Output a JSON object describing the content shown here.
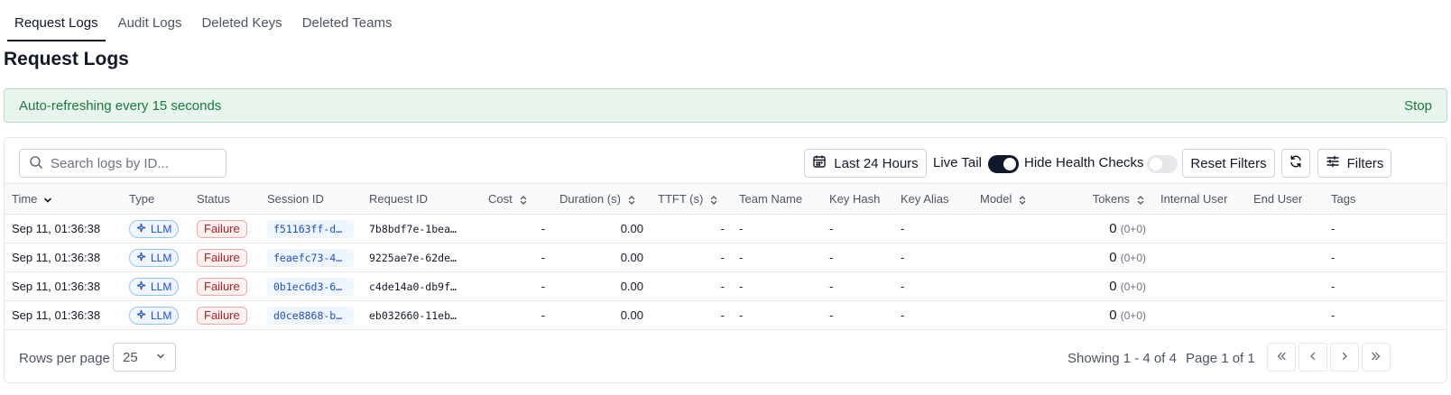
{
  "tabs": [
    {
      "label": "Request Logs",
      "active": true
    },
    {
      "label": "Audit Logs",
      "active": false
    },
    {
      "label": "Deleted Keys",
      "active": false
    },
    {
      "label": "Deleted Teams",
      "active": false
    }
  ],
  "page": {
    "title": "Request Logs"
  },
  "banner": {
    "message": "Auto-refreshing every 15 seconds",
    "stop_label": "Stop"
  },
  "toolbar": {
    "search_placeholder": "Search logs by ID...",
    "time_range_label": "Last 24 Hours",
    "live_tail_label": "Live Tail",
    "live_tail_on": true,
    "hide_health_label": "Hide Health Checks",
    "hide_health_on": false,
    "reset_label": "Reset Filters",
    "filters_label": "Filters"
  },
  "table": {
    "columns": [
      "Time",
      "Type",
      "Status",
      "Session ID",
      "Request ID",
      "Cost",
      "Duration (s)",
      "TTFT (s)",
      "Team Name",
      "Key Hash",
      "Key Alias",
      "Model",
      "Tokens",
      "Internal User",
      "End User",
      "Tags"
    ],
    "rows": [
      {
        "time": "Sep 11, 01:36:38",
        "type": "LLM",
        "status": "Failure",
        "session_id": "f51163ff-da…",
        "request_id": "7b8bdf7e-1bea…",
        "cost": "-",
        "duration": "0.00",
        "ttft": "-",
        "team_name": "-",
        "key_hash": "-",
        "key_alias": "-",
        "model": "",
        "tokens": "0",
        "tokens_detail": "(0+0)",
        "internal_user": "",
        "end_user": "",
        "tags": "-"
      },
      {
        "time": "Sep 11, 01:36:38",
        "type": "LLM",
        "status": "Failure",
        "session_id": "feaefc73-41…",
        "request_id": "9225ae7e-62de…",
        "cost": "-",
        "duration": "0.00",
        "ttft": "-",
        "team_name": "-",
        "key_hash": "-",
        "key_alias": "-",
        "model": "",
        "tokens": "0",
        "tokens_detail": "(0+0)",
        "internal_user": "",
        "end_user": "",
        "tags": "-"
      },
      {
        "time": "Sep 11, 01:36:38",
        "type": "LLM",
        "status": "Failure",
        "session_id": "0b1ec6d3-61…",
        "request_id": "c4de14a0-db9f…",
        "cost": "-",
        "duration": "0.00",
        "ttft": "-",
        "team_name": "-",
        "key_hash": "-",
        "key_alias": "-",
        "model": "",
        "tokens": "0",
        "tokens_detail": "(0+0)",
        "internal_user": "",
        "end_user": "",
        "tags": "-"
      },
      {
        "time": "Sep 11, 01:36:38",
        "type": "LLM",
        "status": "Failure",
        "session_id": "d0ce8868-b8…",
        "request_id": "eb032660-11eb…",
        "cost": "-",
        "duration": "0.00",
        "ttft": "-",
        "team_name": "-",
        "key_hash": "-",
        "key_alias": "-",
        "model": "",
        "tokens": "0",
        "tokens_detail": "(0+0)",
        "internal_user": "",
        "end_user": "",
        "tags": "-"
      }
    ]
  },
  "footer": {
    "rows_per_page_label": "Rows per page",
    "rows_per_page_value": "25",
    "showing_text": "Showing 1 - 4 of 4",
    "page_text": "Page 1 of 1"
  },
  "colors": {
    "banner_bg": "#e8f5ec",
    "banner_text": "#1a7a3c",
    "type_badge": "#1d4ed8",
    "failure_badge": "#b91c1c",
    "toggle_on": "#0f172a"
  },
  "icons": {
    "search": "search-icon",
    "calendar": "calendar-icon",
    "refresh": "refresh-icon",
    "filters": "sliders-icon",
    "sort_desc": "chevron-down-icon",
    "sort": "sort-icon",
    "type": "sparkle-icon"
  }
}
